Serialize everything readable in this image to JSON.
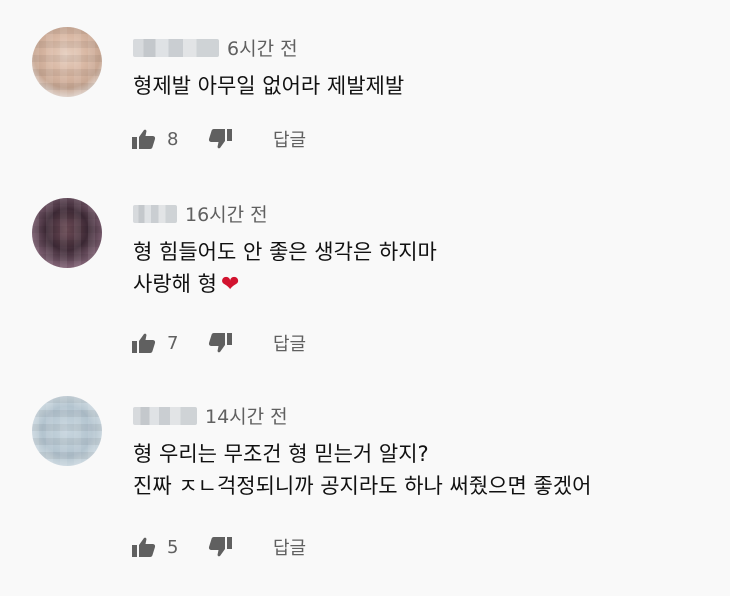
{
  "comments": [
    {
      "time": "6시간 전",
      "lines": [
        "형제발 아무일 없어라 제발제발"
      ],
      "likes": "8",
      "reply_label": "답글"
    },
    {
      "time": "16시간 전",
      "lines": [
        "형 힘들어도 안 좋은 생각은 하지마",
        "사랑해 형"
      ],
      "heart": "❤",
      "likes": "7",
      "reply_label": "답글"
    },
    {
      "time": "14시간 전",
      "lines": [
        "형 우리는 무조건 형 믿는거 알지?",
        "진짜 ㅈㄴ걱정되니까 공지라도 하나 써줬으면 좋겠어"
      ],
      "likes": "5",
      "reply_label": "답글"
    }
  ],
  "icons": {
    "like": "thumbs-up-icon",
    "dislike": "thumbs-down-icon",
    "heart": "heart-emoji"
  },
  "colors": {
    "background": "#f9f9f9",
    "secondary_text": "#606060",
    "heart": "#d2132f"
  }
}
